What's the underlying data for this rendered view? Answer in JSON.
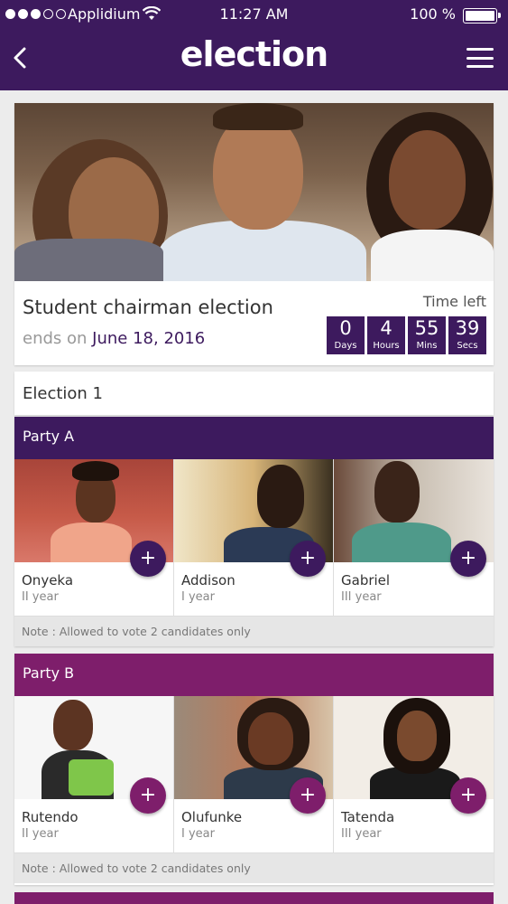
{
  "status_bar": {
    "carrier": "Applidium",
    "time": "11:27 AM",
    "battery": "100 %"
  },
  "header": {
    "logo": "election",
    "back_icon": "chevron-left-icon",
    "menu_icon": "hamburger-menu-icon"
  },
  "hero": {
    "title": "Student chairman election",
    "ends_prefix": "ends on",
    "ends_date": "June 18, 2016",
    "time_left_label": "Time left",
    "countdown": [
      {
        "value": "0",
        "unit": "Days"
      },
      {
        "value": "4",
        "unit": "Hours"
      },
      {
        "value": "55",
        "unit": "Mins"
      },
      {
        "value": "39",
        "unit": "Secs"
      }
    ]
  },
  "election": {
    "title": "Election 1"
  },
  "parties": [
    {
      "name": "Party A",
      "color": "#3d1a5e",
      "note": "Note : Allowed to vote 2 candidates only",
      "candidates": [
        {
          "name": "Onyeka",
          "year": "II year"
        },
        {
          "name": "Addison",
          "year": "I year"
        },
        {
          "name": "Gabriel",
          "year": "III year"
        }
      ]
    },
    {
      "name": "Party B",
      "color": "#7e1e6b",
      "note": "Note : Allowed to vote 2 candidates only",
      "candidates": [
        {
          "name": "Rutendo",
          "year": "II year"
        },
        {
          "name": "Olufunke",
          "year": "I year"
        },
        {
          "name": "Tatenda",
          "year": "III year"
        }
      ]
    }
  ],
  "plus_label": "+"
}
